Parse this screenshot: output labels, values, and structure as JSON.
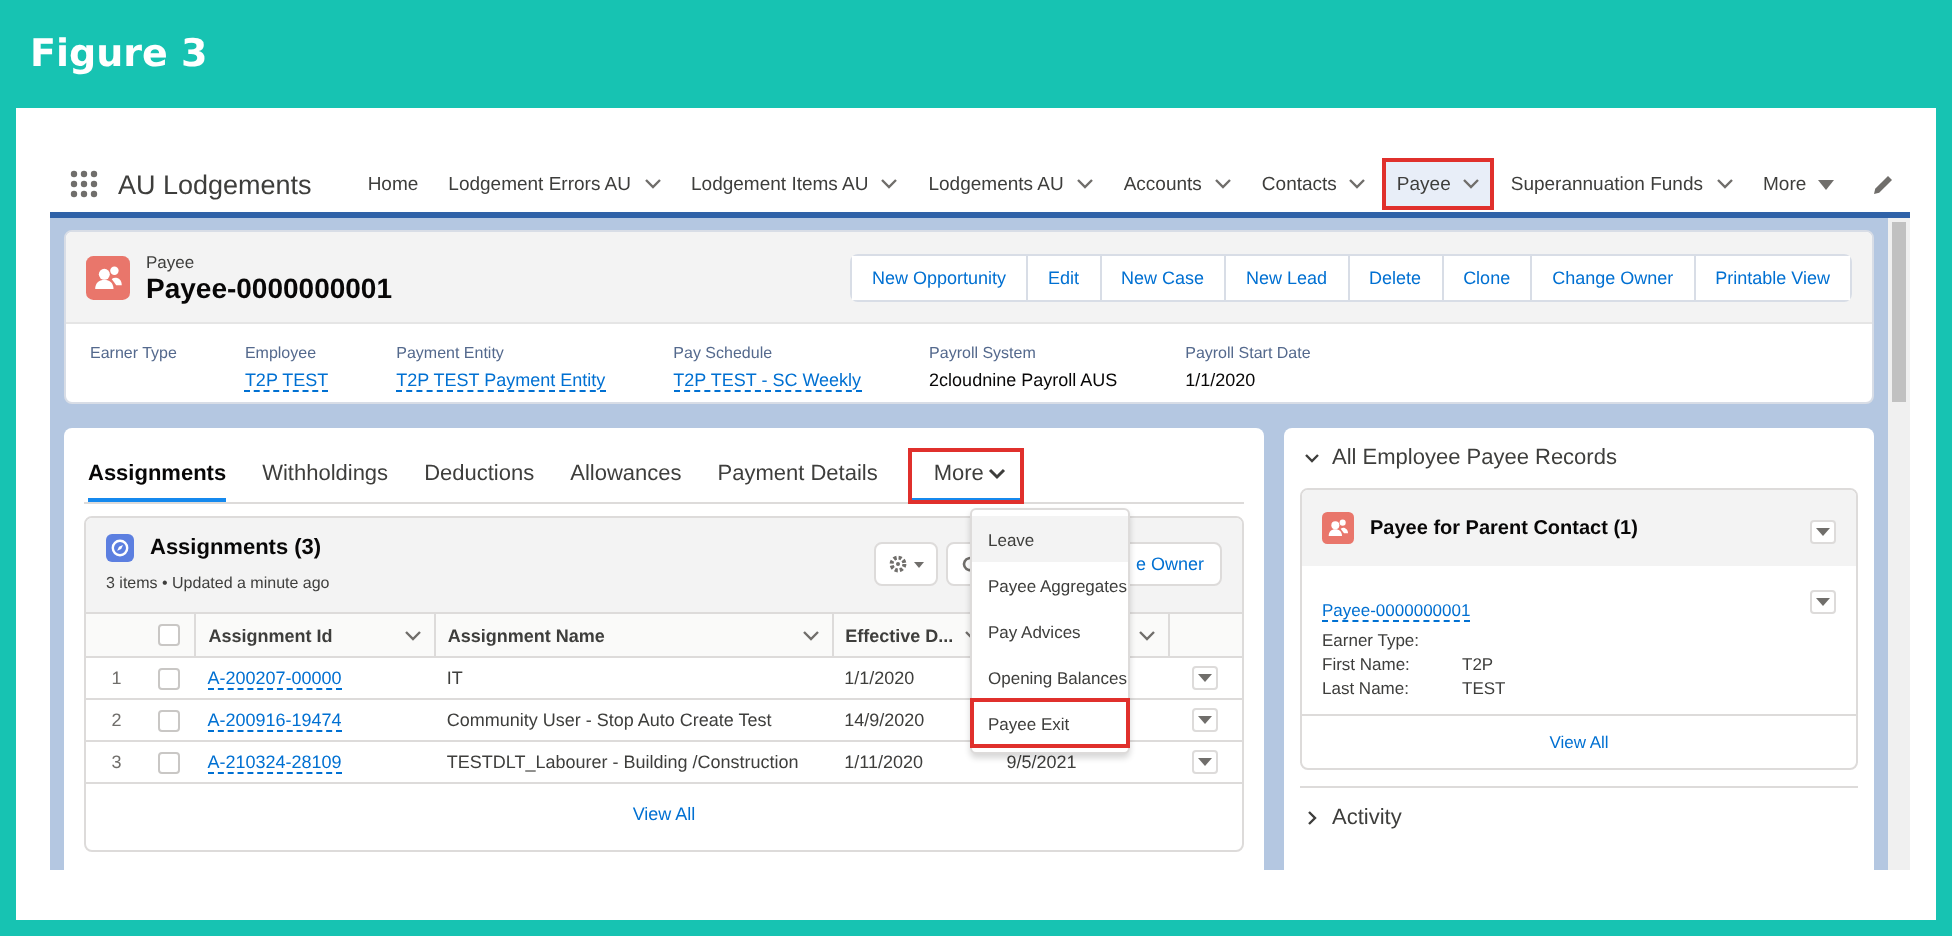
{
  "figure": {
    "title": "Figure 3"
  },
  "app": {
    "name": "AU Lodgements"
  },
  "nav": [
    {
      "label": "Home",
      "kind": "link",
      "selected": false,
      "highlighted": false
    },
    {
      "label": "Lodgement Errors AU",
      "kind": "dropdown",
      "selected": false,
      "highlighted": false
    },
    {
      "label": "Lodgement Items AU",
      "kind": "dropdown",
      "selected": false,
      "highlighted": false
    },
    {
      "label": "Lodgements AU",
      "kind": "dropdown",
      "selected": false,
      "highlighted": false
    },
    {
      "label": "Accounts",
      "kind": "dropdown",
      "selected": false,
      "highlighted": false
    },
    {
      "label": "Contacts",
      "kind": "dropdown",
      "selected": false,
      "highlighted": false
    },
    {
      "label": "Payee",
      "kind": "dropdown",
      "selected": true,
      "highlighted": true
    },
    {
      "label": "Superannuation Funds",
      "kind": "dropdown",
      "selected": false,
      "highlighted": false
    },
    {
      "label": "More",
      "kind": "overflow",
      "selected": false,
      "highlighted": false
    }
  ],
  "record": {
    "object_label": "Payee",
    "name": "Payee-0000000001",
    "actions": [
      "New Opportunity",
      "Edit",
      "New Case",
      "New Lead",
      "Delete",
      "Clone",
      "Change Owner",
      "Printable View"
    ],
    "fields": [
      {
        "label": "Earner Type"
      },
      {
        "label": "Employee",
        "value": "T2P TEST",
        "link": true
      },
      {
        "label": "Payment Entity",
        "value": "T2P TEST Payment Entity",
        "link": true
      },
      {
        "label": "Pay Schedule",
        "value": "T2P TEST - SC Weekly",
        "link": true
      },
      {
        "label": "Payroll System",
        "value": "2cloudnine Payroll AUS",
        "link": false
      },
      {
        "label": "Payroll Start Date",
        "value": "1/1/2020",
        "link": false
      }
    ]
  },
  "tabs": [
    {
      "label": "Assignments",
      "selected": true,
      "open": false,
      "highlighted": false,
      "caret": false
    },
    {
      "label": "Withholdings",
      "selected": false,
      "open": false,
      "highlighted": false,
      "caret": false
    },
    {
      "label": "Deductions",
      "selected": false,
      "open": false,
      "highlighted": false,
      "caret": false
    },
    {
      "label": "Allowances",
      "selected": false,
      "open": false,
      "highlighted": false,
      "caret": false
    },
    {
      "label": "Payment Details",
      "selected": false,
      "open": false,
      "highlighted": false,
      "caret": false
    },
    {
      "label": "More",
      "selected": false,
      "open": true,
      "highlighted": true,
      "caret": true
    }
  ],
  "related_list": {
    "title": "Assignments (3)",
    "meta": "3 items • Updated a minute ago",
    "owner_button": "e Owner",
    "all_selected": false,
    "columns": [
      {
        "label": "Assignment Id"
      },
      {
        "label": "Assignment Name"
      },
      {
        "label": "Effective D..."
      }
    ],
    "rows": [
      {
        "number": "1",
        "checked": false,
        "assignment_id": "A-200207-00000",
        "assignment_name": "IT",
        "effective_date": "1/1/2020"
      },
      {
        "number": "2",
        "checked": false,
        "assignment_id": "A-200916-19474",
        "assignment_name": "Community User - Stop Auto Create Test",
        "effective_date": "14/9/2020"
      },
      {
        "number": "3",
        "checked": false,
        "assignment_id": "A-210324-28109",
        "assignment_name": "TESTDLT_Labourer - Building /Construction",
        "effective_date": "1/11/2020",
        "column_5": "9/5/2021"
      }
    ],
    "view_all": "View All"
  },
  "more_menu": {
    "items": [
      {
        "label": "Leave",
        "hovered": true,
        "highlighted": false
      },
      {
        "label": "Payee Aggregates",
        "hovered": false,
        "highlighted": false
      },
      {
        "label": "Pay Advices",
        "hovered": false,
        "highlighted": false
      },
      {
        "label": "Opening Balances",
        "hovered": false,
        "highlighted": false
      },
      {
        "label": "Payee Exit",
        "hovered": false,
        "highlighted": true
      }
    ]
  },
  "side_panel": {
    "sections": [
      {
        "title": "All Employee Payee Records",
        "expanded": true,
        "card": {
          "title": "Payee for Parent Contact (1)",
          "record": "Payee-0000000001",
          "fields": [
            {
              "label": "Earner Type:"
            },
            {
              "label": "First Name:",
              "value": "T2P"
            },
            {
              "label": "Last Name:",
              "value": "TEST"
            }
          ],
          "view_all": "View All"
        }
      },
      {
        "title": "Activity",
        "expanded": false
      }
    ]
  }
}
